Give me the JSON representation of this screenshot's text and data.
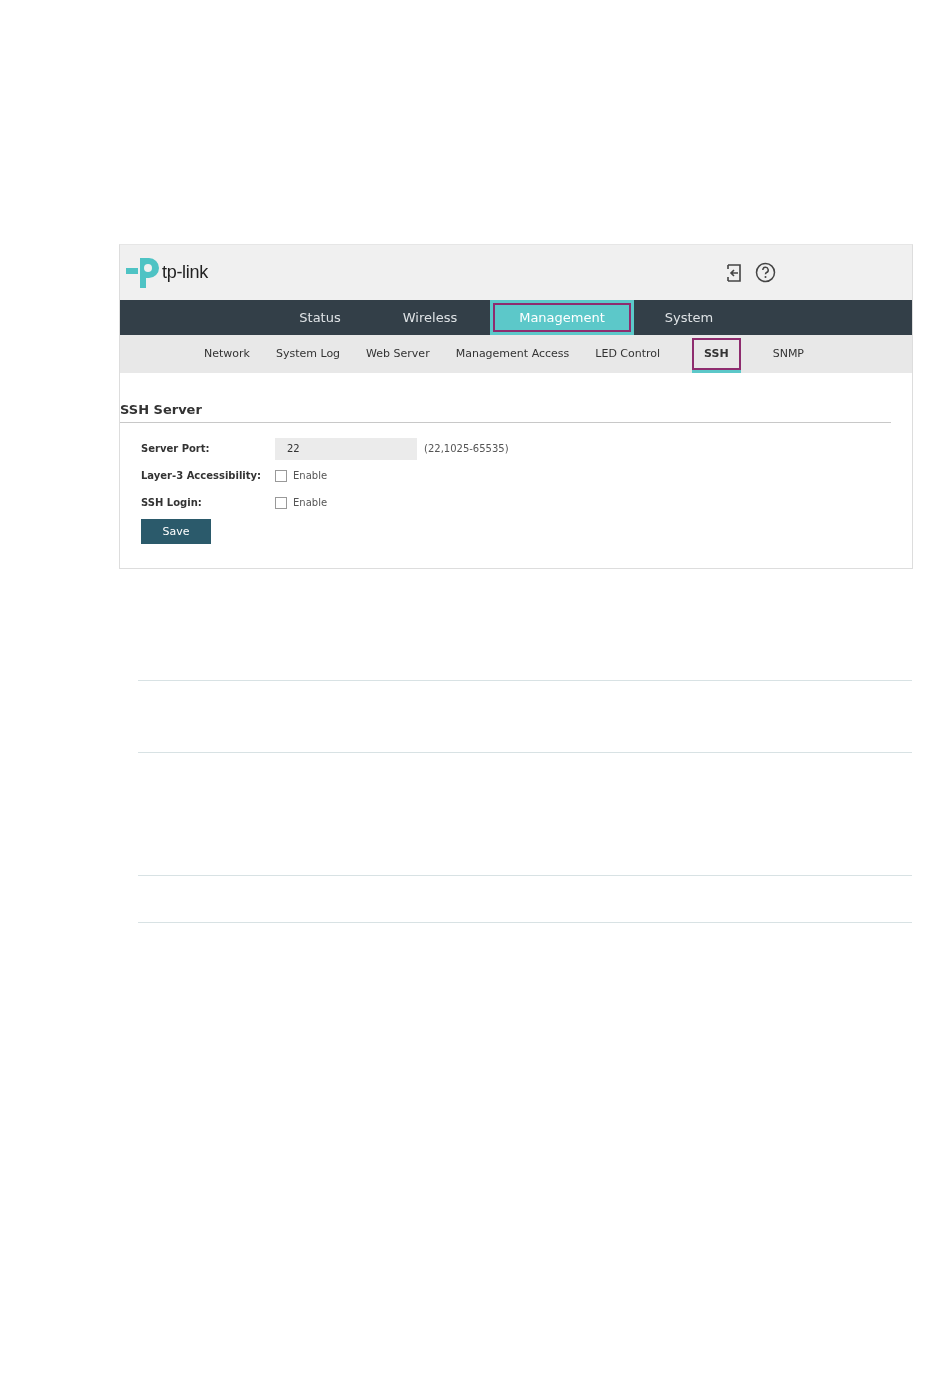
{
  "brand": {
    "name": "tp-link"
  },
  "main_tabs": [
    {
      "label": "Status",
      "selected": false
    },
    {
      "label": "Wireless",
      "selected": false
    },
    {
      "label": "Management",
      "selected": true
    },
    {
      "label": "System",
      "selected": false
    }
  ],
  "sub_tabs": [
    {
      "label": "Network",
      "selected": false
    },
    {
      "label": "System Log",
      "selected": false
    },
    {
      "label": "Web Server",
      "selected": false
    },
    {
      "label": "Management Access",
      "selected": false
    },
    {
      "label": "LED Control",
      "selected": false
    },
    {
      "label": "SSH",
      "selected": true
    },
    {
      "label": "SNMP",
      "selected": false
    }
  ],
  "section": {
    "title": "SSH Server",
    "fields": [
      {
        "kind": "input",
        "label": "Server Port:",
        "value": "22",
        "hint": "(22,1025-65535)"
      },
      {
        "kind": "checkbox",
        "label": "Layer-3 Accessibility:",
        "option": "Enable",
        "checked": false
      },
      {
        "kind": "checkbox",
        "label": "SSH Login:",
        "option": "Enable",
        "checked": false
      }
    ],
    "button": "Save"
  }
}
